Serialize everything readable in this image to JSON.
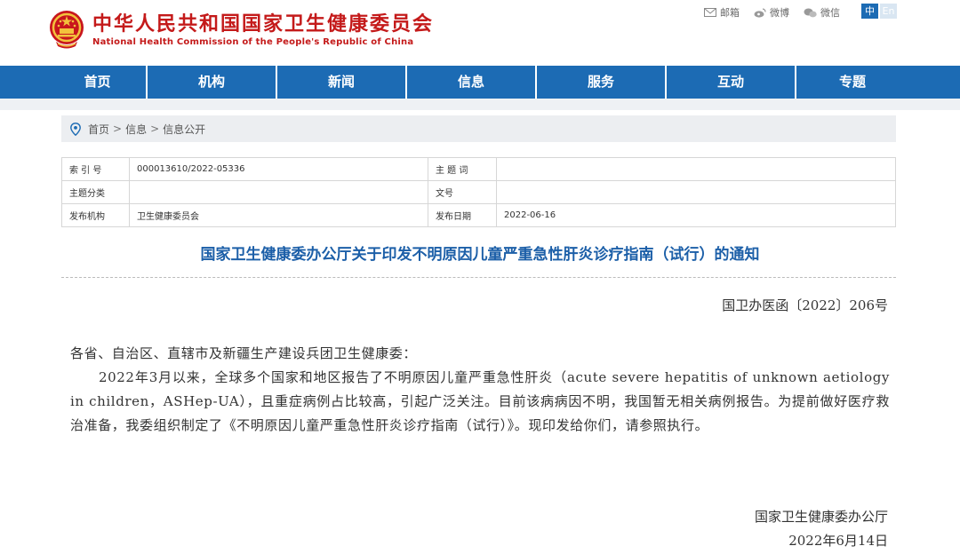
{
  "site": {
    "title_cn": "中华人民共和国国家卫生健康委员会",
    "title_en": "National Health Commission of the People's Republic of China"
  },
  "toplinks": [
    {
      "label": "邮箱",
      "icon": "mail-icon"
    },
    {
      "label": "微博",
      "icon": "weibo-icon"
    },
    {
      "label": "微信",
      "icon": "wechat-icon"
    }
  ],
  "lang": {
    "zh": "中",
    "en": "En"
  },
  "nav": [
    "首页",
    "机构",
    "新闻",
    "信息",
    "服务",
    "互动",
    "专题"
  ],
  "breadcrumb": {
    "home": "首页",
    "level1": "信息",
    "level2": "信息公开",
    "sep": ">"
  },
  "meta": {
    "index_label": "索 引 号",
    "index_value": "000013610/2022-05336",
    "subject_label": "主 题 词",
    "subject_value": "",
    "category_label": "主题分类",
    "category_value": "",
    "docno_label": "文号",
    "docno_value": "",
    "issuer_label": "发布机构",
    "issuer_value": "卫生健康委员会",
    "date_label": "发布日期",
    "date_value": "2022-06-16"
  },
  "doc": {
    "title": "国家卫生健康委办公厅关于印发不明原因儿童严重急性肝炎诊疗指南（试行）的通知",
    "number": "国卫办医函〔2022〕206号",
    "address": "各省、自治区、直辖市及新疆生产建设兵团卫生健康委：",
    "paragraph": "2022年3月以来，全球多个国家和地区报告了不明原因儿童严重急性肝炎（acute severe hepatitis of unknown aetiology in children，ASHep-UA），且重症病例占比较高，引起广泛关注。目前该病病因不明，我国暂无相关病例报告。为提前做好医疗救治准备，我委组织制定了《不明原因儿童严重急性肝炎诊疗指南（试行）》。现印发给你们，请参照执行。",
    "signer": "国家卫生健康委办公厅",
    "sign_date": "2022年6月14日"
  },
  "colors": {
    "nav": "#1c6bb4",
    "title_red": "#c41a1a",
    "doc_title": "#1c5fa8"
  }
}
